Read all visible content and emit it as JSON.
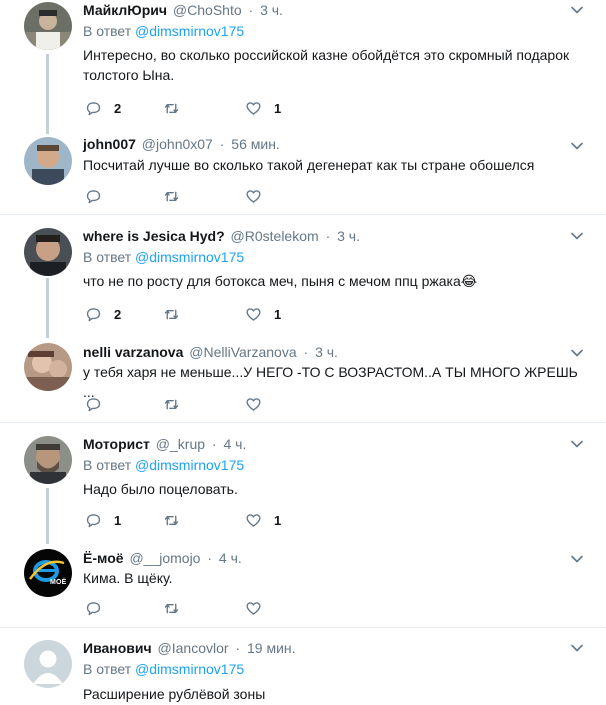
{
  "reply_prefix": "В ответ",
  "tweets": [
    {
      "name": "МайклЮрич",
      "handle": "@ChoShto",
      "time": "3 ч.",
      "reply_to": "@dimsmirnov175",
      "text": "Интересно, во сколько российской казне обойдётся это скромный подарок толстого Ына.",
      "replies": "2",
      "retweets": "",
      "likes": "1"
    },
    {
      "name": "john007",
      "handle": "@john0x07",
      "time": "56 мин.",
      "reply_to": "",
      "text": "Посчитай лучше во сколько такой дегенерат как ты стране обошелся",
      "replies": "",
      "retweets": "",
      "likes": ""
    },
    {
      "name": "where is Jesica Hyd?",
      "handle": "@R0stelekom",
      "time": "3 ч.",
      "reply_to": "@dimsmirnov175",
      "text": "что не по росту для ботокса меч, пыня с мечом ппц ржака😂",
      "replies": "2",
      "retweets": "",
      "likes": "1"
    },
    {
      "name": "nelli varzanova",
      "handle": "@NelliVarzanova",
      "time": "3 ч.",
      "reply_to": "",
      "text": "у тебя харя не меньше...У НЕГО -ТО С ВОЗРАСТОМ..А ТЫ МНОГО ЖРЕШЬ ...",
      "replies": "",
      "retweets": "",
      "likes": ""
    },
    {
      "name": "Моторист",
      "handle": "@_krup",
      "time": "4 ч.",
      "reply_to": "@dimsmirnov175",
      "text": "Надо было поцеловать.",
      "replies": "1",
      "retweets": "",
      "likes": "1"
    },
    {
      "name": "Ё-моё",
      "handle": "@__jomojo",
      "time": "4 ч.",
      "reply_to": "",
      "text": "Кима. В щёку.",
      "replies": "",
      "retweets": "",
      "likes": ""
    },
    {
      "name": "Иванович",
      "handle": "@Iancovlor",
      "time": "19 мин.",
      "reply_to": "@dimsmirnov175",
      "text": "Расширение рублёвой зоны",
      "replies": "",
      "retweets": "",
      "likes": ""
    }
  ],
  "avatar_logo_text": "МОЁ",
  "colors": {
    "link": "#1da1f2",
    "muted": "#657786",
    "thread_line": "#c4cfd6",
    "icon": "#657786"
  },
  "icons": {
    "reply": "reply-icon",
    "retweet": "retweet-icon",
    "like": "heart-icon",
    "menu": "chevron-down-icon"
  }
}
